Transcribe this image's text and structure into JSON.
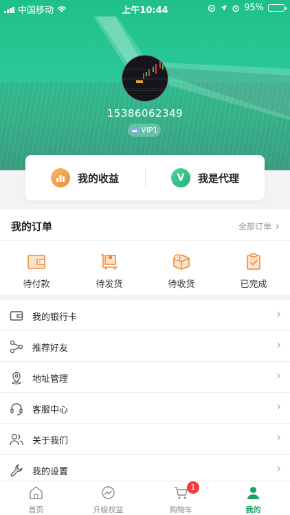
{
  "status_bar": {
    "carrier": "中国移动",
    "time": "上午10:44",
    "battery": "95%",
    "battery_level": 0.95
  },
  "profile": {
    "phone": "15386062349",
    "vip": "VIP1"
  },
  "earnings_card": {
    "income_label": "我的收益",
    "agent_label": "我是代理",
    "agent_icon_letter": "V"
  },
  "orders": {
    "title": "我的订单",
    "all_label": "全部订单",
    "items": [
      {
        "label": "待付款",
        "icon": "wallet-icon"
      },
      {
        "label": "待发货",
        "icon": "package-cart-icon"
      },
      {
        "label": "待收货",
        "icon": "delivery-box-icon"
      },
      {
        "label": "已完成",
        "icon": "completed-clipboard-icon"
      }
    ]
  },
  "menu": [
    {
      "label": "我的银行卡",
      "icon": "bank-card-icon"
    },
    {
      "label": "推荐好友",
      "icon": "share-icon"
    },
    {
      "label": "地址管理",
      "icon": "location-pin-icon"
    },
    {
      "label": "客服中心",
      "icon": "headset-icon"
    },
    {
      "label": "关于我们",
      "icon": "users-icon"
    },
    {
      "label": "我的设置",
      "icon": "wrench-icon"
    }
  ],
  "tabs": [
    {
      "label": "首页",
      "icon": "home-icon"
    },
    {
      "label": "升级权益",
      "icon": "trend-icon"
    },
    {
      "label": "购物车",
      "icon": "cart-icon",
      "badge": "1"
    },
    {
      "label": "我的",
      "icon": "person-icon",
      "active": true
    }
  ],
  "colors": {
    "accent": "#17a461",
    "header": "#2ac796",
    "orange": "#f39a4a",
    "badge": "#f03c3c"
  }
}
